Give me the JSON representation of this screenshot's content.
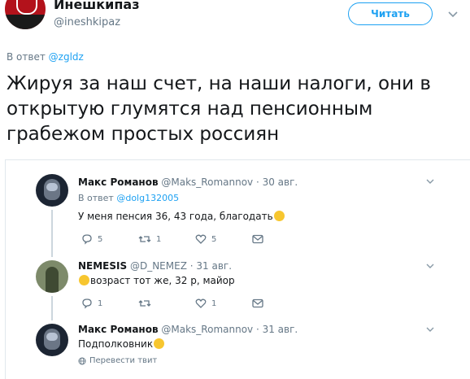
{
  "tweet": {
    "author_name": "Инешкипаз",
    "author_handle": "@ineshkipaz",
    "follow_label": "Читать",
    "reply_prefix": "В ответ",
    "reply_mention": "@zgldz",
    "text": "Жируя за наш счет, на наши налоги, они в открытую глумятся над пенсионным грабежом простых россиян"
  },
  "replies": [
    {
      "name": "Макс Романов",
      "handle": "@Maks_Romannov",
      "date": "· 30 авг.",
      "reply_prefix": "В ответ",
      "reply_mention": "@dolg132005",
      "text": "У меня пенсия 36, 43 года, благодать",
      "replies": "5",
      "retweets": "1",
      "likes": "5"
    },
    {
      "name": "NEMESIS",
      "handle": "@D_NEMEZ",
      "date": "· 31 авг.",
      "text": "возраст тот же,  32 р, майор",
      "replies": "1",
      "retweets": "",
      "likes": "1"
    },
    {
      "name": "Макс Романов",
      "handle": "@Maks_Romannov",
      "date": "· 31 авг.",
      "text": "Подполковник",
      "translate_label": "Перевести твит"
    }
  ],
  "colors": {
    "accent": "#1da1f2",
    "muted": "#657786",
    "text": "#14171a"
  }
}
